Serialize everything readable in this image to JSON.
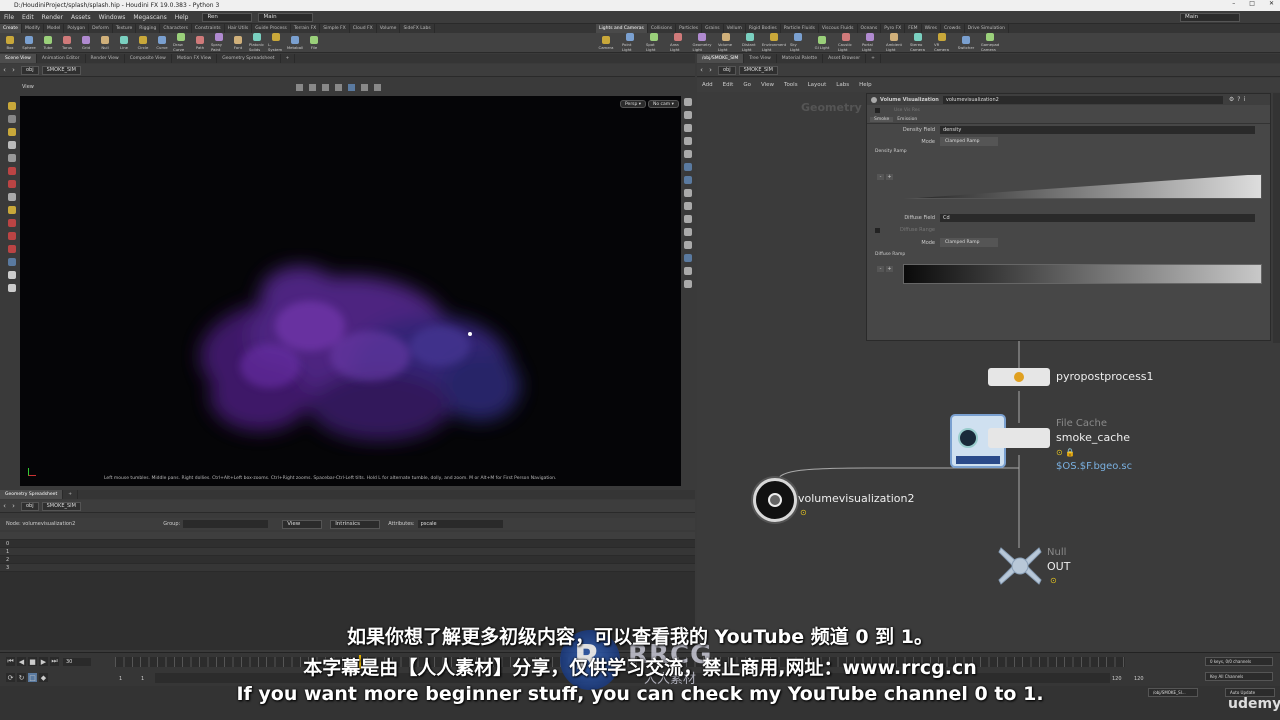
{
  "window": {
    "title": "D:/HoudiniProject/splash/splash.hip - Houdini FX 19.0.383 - Python 3"
  },
  "menu": {
    "items": [
      "File",
      "Edit",
      "Render",
      "Assets",
      "Windows",
      "Megascans",
      "Help"
    ],
    "desktop": "Ren",
    "build": "Main",
    "right_desktop": "Main"
  },
  "shelf": {
    "tabs_left": [
      "Create",
      "Modify",
      "Model",
      "Polygon",
      "Deform",
      "Texture",
      "Rigging",
      "Characters",
      "Constraints",
      "Hair Utils",
      "Guide Process",
      "Terrain FX",
      "Simple FX",
      "Cloud FX",
      "Volume",
      "SideFX Labs"
    ],
    "tabs_right": [
      "Lights and Cameras",
      "Collisions",
      "Particles",
      "Grains",
      "Vellum",
      "Rigid Bodies",
      "Particle Fluids",
      "Viscous Fluids",
      "Oceans",
      "Pyro FX",
      "FEM",
      "Wires",
      "Crowds",
      "Drive Simulation"
    ],
    "tools_left": [
      "Box",
      "Sphere",
      "Tube",
      "Torus",
      "Grid",
      "Null",
      "Line",
      "Circle",
      "Curve",
      "Draw Curve",
      "Path",
      "Spray Paint",
      "Font",
      "Platonic Solids",
      "L-System",
      "Metaball",
      "File"
    ],
    "tools_right": [
      "Camera",
      "Point Light",
      "Spot Light",
      "Area Light",
      "Geometry Light",
      "Volume Light",
      "Distant Light",
      "Environment Light",
      "Sky Light",
      "GI Light",
      "Caustic Light",
      "Portal Light",
      "Ambient Light",
      "Stereo Camera",
      "VR Camera",
      "Switcher",
      "Gamepad Camera"
    ]
  },
  "left_tabs": [
    "Scene View",
    "Animation Editor",
    "Render View",
    "Composite View",
    "Motion FX View",
    "Geometry Spreadsheet"
  ],
  "right_tabs": [
    "/obj/SMOKE_SIM",
    "Tree View",
    "Material Palette",
    "Asset Browser"
  ],
  "left_path": {
    "root": "obj",
    "node": "SMOKE_SIM"
  },
  "right_path": {
    "root": "obj",
    "node": "SMOKE_SIM"
  },
  "viewport": {
    "label": "View",
    "persp": "Persp ▾",
    "cam": "No cam ▾",
    "help": "Left mouse tumbles. Middle pans. Right dollies. Ctrl+Alt+Left box-zooms. Ctrl+Right zooms. Spacebar-Ctrl-Left tilts. Hold L for alternate tumble, dolly, and zoom.     M or Alt+M for First Person Navigation."
  },
  "spreadsheet": {
    "tab": "Geometry Spreadsheet",
    "node_label": "Node: volumevisualization2",
    "group_label": "Group:",
    "view": "View",
    "intrinsics": "Intrinsics",
    "attributes_label": "Attributes:",
    "attributes_value": "pscale",
    "rows": [
      "0",
      "1",
      "2",
      "3"
    ]
  },
  "network": {
    "menu": [
      "Add",
      "Edit",
      "Go",
      "View",
      "Tools",
      "Layout",
      "Labs",
      "Help"
    ],
    "context": "Geometry"
  },
  "params": {
    "type": "Volume Visualization",
    "name": "volumevisualization2",
    "use_vis_res": "Use Vis Res",
    "tabs": [
      "Smoke",
      "Emission"
    ],
    "density_field_label": "Density Field",
    "density_field": "density",
    "mode_label": "Mode",
    "mode": "Clamped Ramp",
    "density_ramp": "Density Ramp",
    "diffuse_field_label": "Diffuse Field",
    "diffuse_field": "Cd",
    "diffuse_range": "Diffuse Range",
    "mode2": "Clamped Ramp",
    "diffuse_ramp": "Diffuse Ramp"
  },
  "nodes": {
    "pyro": "pyropostprocess1",
    "filecache_type": "File Cache",
    "filecache_name": "smoke_cache",
    "filecache_path": "$OS.$F.bgeo.sc",
    "volvis": "volumevisualization2",
    "null_type": "Null",
    "null_name": "OUT"
  },
  "timeline": {
    "frame": "30",
    "start": "1",
    "start2": "1",
    "end": "120",
    "end2": "120",
    "keys": "0 keys, 0/0 channels",
    "key_all": "Key All Channels",
    "path": "/obj/SMOKE_SI...",
    "auto_update": "Auto Update"
  },
  "subtitles": {
    "line1": "如果你想了解更多初级内容，可以查看我的 YouTube 频道 0 到 1。",
    "line2": "本字幕是由【人人素材】分享，仅供学习交流，禁止商用,网址：www.rrcg.cn",
    "line3": "If you want more beginner stuff, you can check my YouTube channel 0 to 1."
  },
  "watermark": {
    "brand": "RRCG",
    "sub": "人人素材",
    "udemy": "udemy"
  },
  "colors": {
    "smoke": "#6a2fa8",
    "node_yellow": "#e0c020",
    "accent": "#f0b000"
  }
}
